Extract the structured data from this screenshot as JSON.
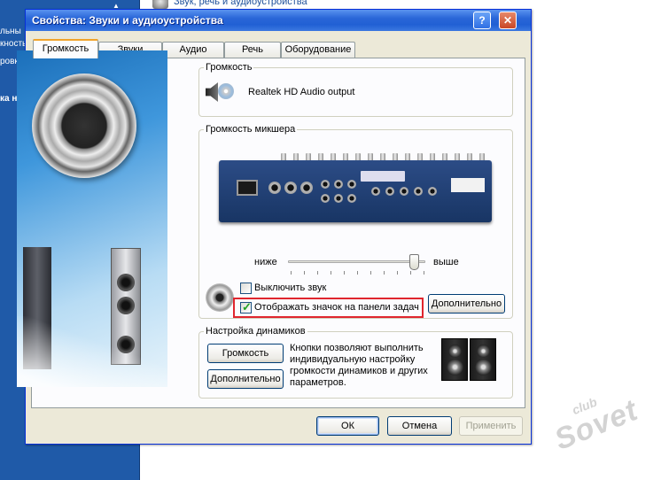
{
  "background": {
    "left_fragments": [
      "льны",
      "кность",
      "ровка",
      "ка не"
    ],
    "top_window_title": "Звук, речь и аудиоустройства"
  },
  "dialog": {
    "title": "Свойства: Звуки и аудиоустройства",
    "help_glyph": "?",
    "close_glyph": "✕",
    "tabs": [
      {
        "label": "Громкость",
        "active": true
      },
      {
        "label": "Звуки",
        "active": false
      },
      {
        "label": "Аудио",
        "active": false
      },
      {
        "label": "Речь",
        "active": false
      },
      {
        "label": "Оборудование",
        "active": false
      }
    ]
  },
  "volume_group": {
    "label": "Громкость",
    "device_name": "Realtek HD Audio output"
  },
  "mixer_group": {
    "label": "Громкость микшера",
    "low_label": "ниже",
    "high_label": "выше",
    "level_percent": 95,
    "mute_label": "Выключить звук",
    "mute_checked": false,
    "show_icon_label": "Отображать значок на панели задач",
    "show_icon_checked": true,
    "advanced_button": "Дополнительно"
  },
  "speakers_group": {
    "label": "Настройка динамиков",
    "volume_button": "Громкость",
    "advanced_button": "Дополнительно",
    "description": "Кнопки позволяют выполнить индивидуальную настройку громкости динамиков и других параметров."
  },
  "buttons": {
    "ok": "ОК",
    "cancel": "Отмена",
    "apply": "Применить"
  },
  "watermark": {
    "line1": "club",
    "line2": "Sovet"
  }
}
